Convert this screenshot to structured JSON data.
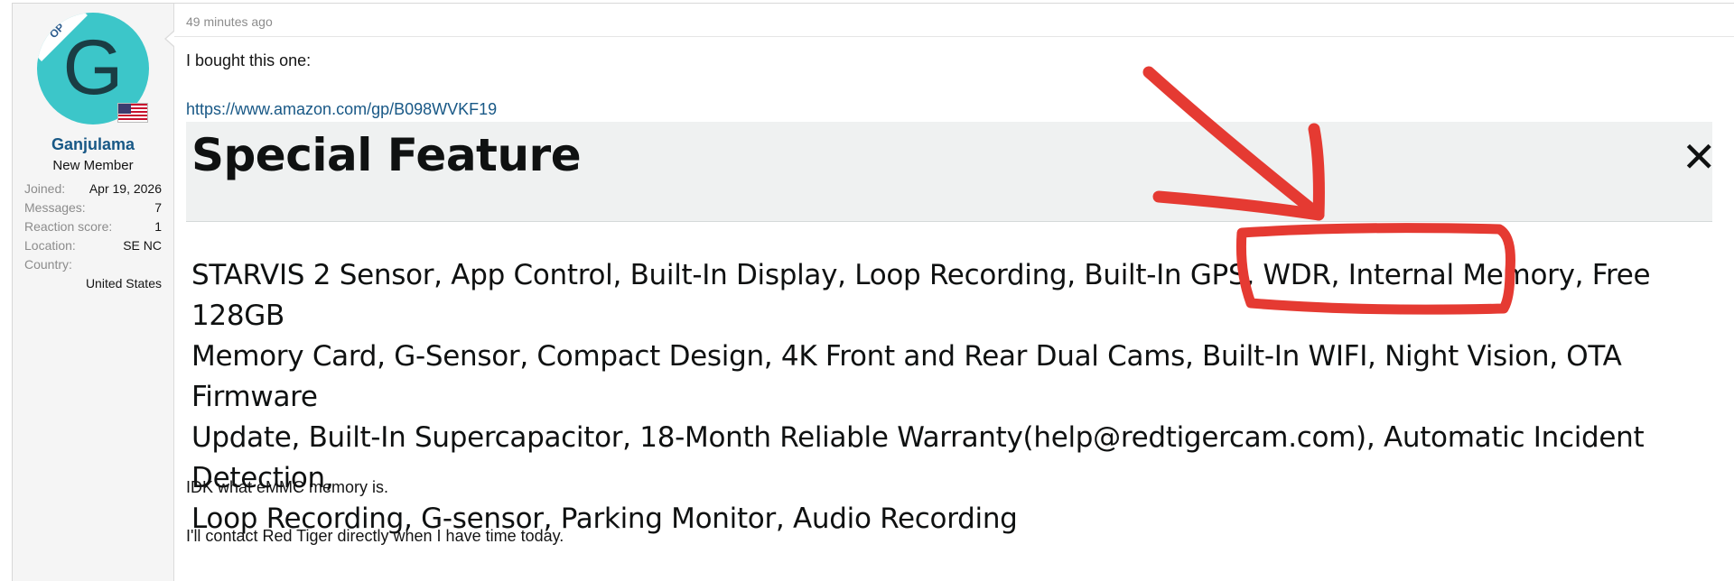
{
  "user": {
    "avatar_letter": "G",
    "op_badge": "OP",
    "flag_icon": "us-flag-icon",
    "name": "Ganjulama",
    "title": "New Member",
    "stats": [
      {
        "key": "Joined:",
        "value": "Apr 19, 2026"
      },
      {
        "key": "Messages:",
        "value": "7"
      },
      {
        "key": "Reaction score:",
        "value": "1"
      },
      {
        "key": "Location:",
        "value": "SE NC"
      },
      {
        "key": "Country:",
        "value": "United States"
      }
    ],
    "avatar_color": "#3cc6c9"
  },
  "post": {
    "timestamp": "49 minutes ago",
    "line1": "I bought this one:",
    "link": "https://www.amazon.com/gp/B098WVKF19",
    "embedded_image": {
      "title": "Special Feature",
      "close_glyph": "✕",
      "lines": [
        "STARVIS 2 Sensor, App Control, Built-In Display, Loop Recording, Built-In GPS, WDR, Internal Memory, Free 128GB",
        "Memory Card, G-Sensor, Compact Design, 4K Front and Rear Dual Cams, Built-In WIFI, Night Vision, OTA Firmware",
        "Update, Built-In Supercapacitor, 18-Month Reliable Warranty(help@redtigercam.com), Automatic Incident Detection,",
        "Loop Recording, G-sensor, Parking Monitor, Audio Recording"
      ],
      "annotation_color": "#e53a32"
    },
    "line2": "IDK what eMMC memory is.",
    "line3": "I'll contact Red Tiger directly when I have time today."
  },
  "colors": {
    "link": "#185886",
    "username": "#185886",
    "muted": "#8c8c8c"
  }
}
